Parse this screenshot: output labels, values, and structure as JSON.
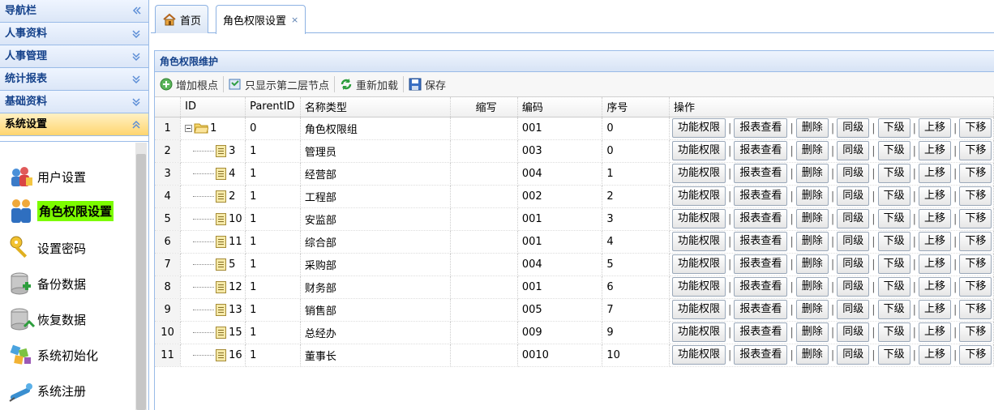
{
  "sidebar": {
    "headers": [
      {
        "label": "导航栏",
        "icon": "double-chevron-left-icon"
      },
      {
        "label": "人事资料",
        "icon": "double-chevron-down-icon"
      },
      {
        "label": "人事管理",
        "icon": "double-chevron-down-icon"
      },
      {
        "label": "统计报表",
        "icon": "double-chevron-down-icon"
      },
      {
        "label": "基础资料",
        "icon": "double-chevron-down-icon"
      },
      {
        "label": "系统设置",
        "icon": "double-chevron-up-icon"
      }
    ],
    "items": [
      {
        "label": "用户设置",
        "icon": "users-icon"
      },
      {
        "label": "角色权限设置",
        "icon": "role-users-icon",
        "active": true
      },
      {
        "label": "设置密码",
        "icon": "key-icon"
      },
      {
        "label": "备份数据",
        "icon": "database-backup-icon"
      },
      {
        "label": "恢复数据",
        "icon": "database-restore-icon"
      },
      {
        "label": "系统初始化",
        "icon": "system-init-icon"
      },
      {
        "label": "系统注册",
        "icon": "register-icon"
      }
    ]
  },
  "tabs": [
    {
      "label": "首页",
      "icon": "home-icon"
    },
    {
      "label": "角色权限设置",
      "close": "×"
    }
  ],
  "panel": {
    "title": "角色权限维护",
    "toolbar": [
      {
        "label": "增加根点",
        "icon": "add-icon",
        "color": "#4caf50"
      },
      {
        "label": "只显示第二层节点",
        "icon": "filter-icon",
        "color": "#4a7bb7"
      },
      {
        "label": "重新加载",
        "icon": "reload-icon",
        "color": "#2e9e3e"
      },
      {
        "label": "保存",
        "icon": "save-icon",
        "color": "#3a6fc4"
      }
    ]
  },
  "grid": {
    "columns": [
      "ID",
      "ParentID",
      "名称类型",
      "缩写",
      "编码",
      "序号",
      "操作"
    ],
    "actions": [
      "功能权限",
      "报表查看",
      "删除",
      "同级",
      "下级",
      "上移",
      "下移"
    ],
    "separator": "|",
    "rows": [
      {
        "rn": "1",
        "id": "1",
        "parent": "0",
        "name": "角色权限组",
        "abbr": "",
        "code": "001",
        "seq": "0",
        "root": true
      },
      {
        "rn": "2",
        "id": "3",
        "parent": "1",
        "name": "管理员",
        "abbr": "",
        "code": "003",
        "seq": "0"
      },
      {
        "rn": "3",
        "id": "4",
        "parent": "1",
        "name": "经营部",
        "abbr": "",
        "code": "004",
        "seq": "1"
      },
      {
        "rn": "4",
        "id": "2",
        "parent": "1",
        "name": "工程部",
        "abbr": "",
        "code": "002",
        "seq": "2"
      },
      {
        "rn": "5",
        "id": "10",
        "parent": "1",
        "name": "安监部",
        "abbr": "",
        "code": "001",
        "seq": "3"
      },
      {
        "rn": "6",
        "id": "11",
        "parent": "1",
        "name": "综合部",
        "abbr": "",
        "code": "001",
        "seq": "4"
      },
      {
        "rn": "7",
        "id": "5",
        "parent": "1",
        "name": "采购部",
        "abbr": "",
        "code": "004",
        "seq": "5"
      },
      {
        "rn": "8",
        "id": "12",
        "parent": "1",
        "name": "财务部",
        "abbr": "",
        "code": "001",
        "seq": "6"
      },
      {
        "rn": "9",
        "id": "13",
        "parent": "1",
        "name": "销售部",
        "abbr": "",
        "code": "005",
        "seq": "7"
      },
      {
        "rn": "10",
        "id": "15",
        "parent": "1",
        "name": "总经办",
        "abbr": "",
        "code": "009",
        "seq": "9"
      },
      {
        "rn": "11",
        "id": "16",
        "parent": "1",
        "name": "董事长",
        "abbr": "",
        "code": "0010",
        "seq": "10"
      }
    ]
  }
}
